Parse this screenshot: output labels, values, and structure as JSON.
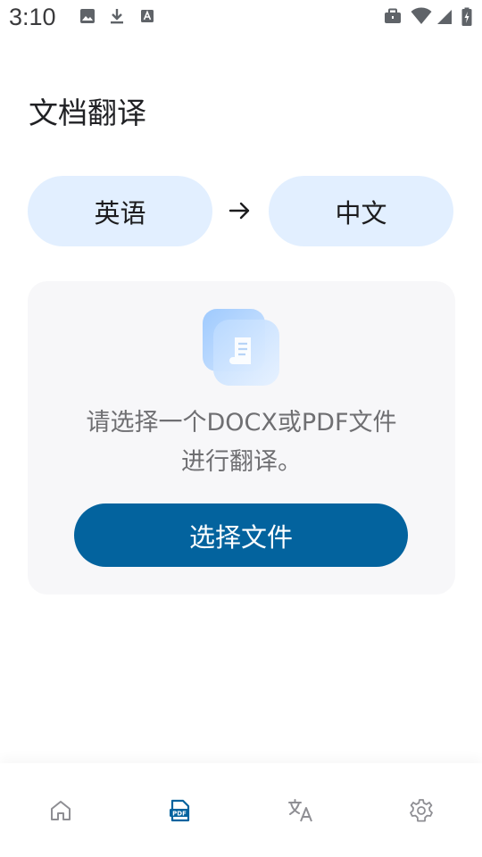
{
  "status_bar": {
    "time": "3:10",
    "left_icons": [
      "image-icon",
      "download-icon",
      "text-a-icon"
    ],
    "right_icons": [
      "briefcase-icon",
      "wifi-icon",
      "cell-signal-icon",
      "battery-charging-icon"
    ]
  },
  "page": {
    "title": "文档翻译"
  },
  "language_selector": {
    "source": "英语",
    "arrow": "→",
    "target": "中文"
  },
  "upload_card": {
    "message_line1": "请选择一个DOCX或PDF文件",
    "message_line2": "进行翻译。",
    "button_label": "选择文件"
  },
  "bottom_nav": {
    "items": [
      {
        "icon": "home-icon",
        "active": false
      },
      {
        "icon": "pdf-document-icon",
        "active": true
      },
      {
        "icon": "translate-icon",
        "active": false
      },
      {
        "icon": "settings-gear-icon",
        "active": false
      }
    ]
  },
  "colors": {
    "accent": "#03639e",
    "pill_bg": "#e2efff",
    "card_bg": "#f7f7f9",
    "muted_text": "#6f6f72",
    "inactive_icon": "#8e8e93"
  }
}
